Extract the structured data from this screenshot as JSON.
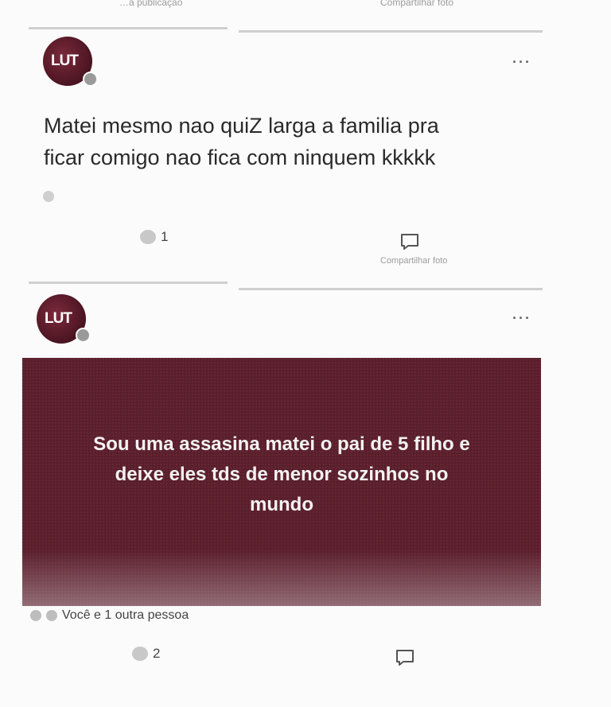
{
  "top_fragment": {
    "left_text": "…a publicação",
    "right_text": "Compartilhar foto"
  },
  "posts": [
    {
      "avatar_text": "LUT",
      "more": "···",
      "text_line1": "Matei mesmo nao quiZ larga a familia pra",
      "text_line2": "ficar comigo nao fica com ninquem kkkkk",
      "reaction_count": "1",
      "faded_share": "Compartilhar foto"
    },
    {
      "avatar_text": "LUT",
      "more": "···",
      "bg_line1": "Sou uma assasina matei o pai de 5 filho e",
      "bg_line2": "deixe eles tds de menor sozinhos no",
      "bg_line3": "mundo",
      "reactors": "Você e 1 outra pessoa",
      "reaction_count": "2"
    }
  ]
}
